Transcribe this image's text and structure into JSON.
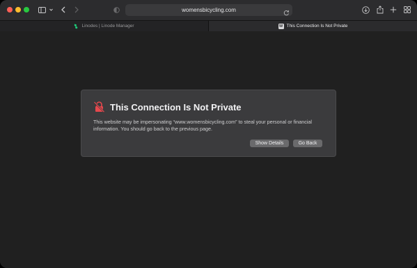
{
  "window": {
    "address": "womensbicycling.com"
  },
  "tabs": [
    {
      "label": "Linodes | Linode Manager",
      "active": false,
      "favicon": "linode-logo-icon"
    },
    {
      "label": "This Connection Is Not Private",
      "active": true,
      "favicon": "w-favicon-icon",
      "favicon_letter": "W"
    }
  ],
  "dialog": {
    "title": "This Connection Is Not Private",
    "body": "This website may be impersonating “www.womensbicycling.com” to steal your personal or financial information. You should go back to the previous page.",
    "show_details_label": "Show Details",
    "go_back_label": "Go Back",
    "icon": "broken-lock-icon",
    "icon_color": "#e5484d"
  },
  "colors": {
    "accent_red": "#e5484d",
    "linode_green": "#1ecc7a"
  }
}
